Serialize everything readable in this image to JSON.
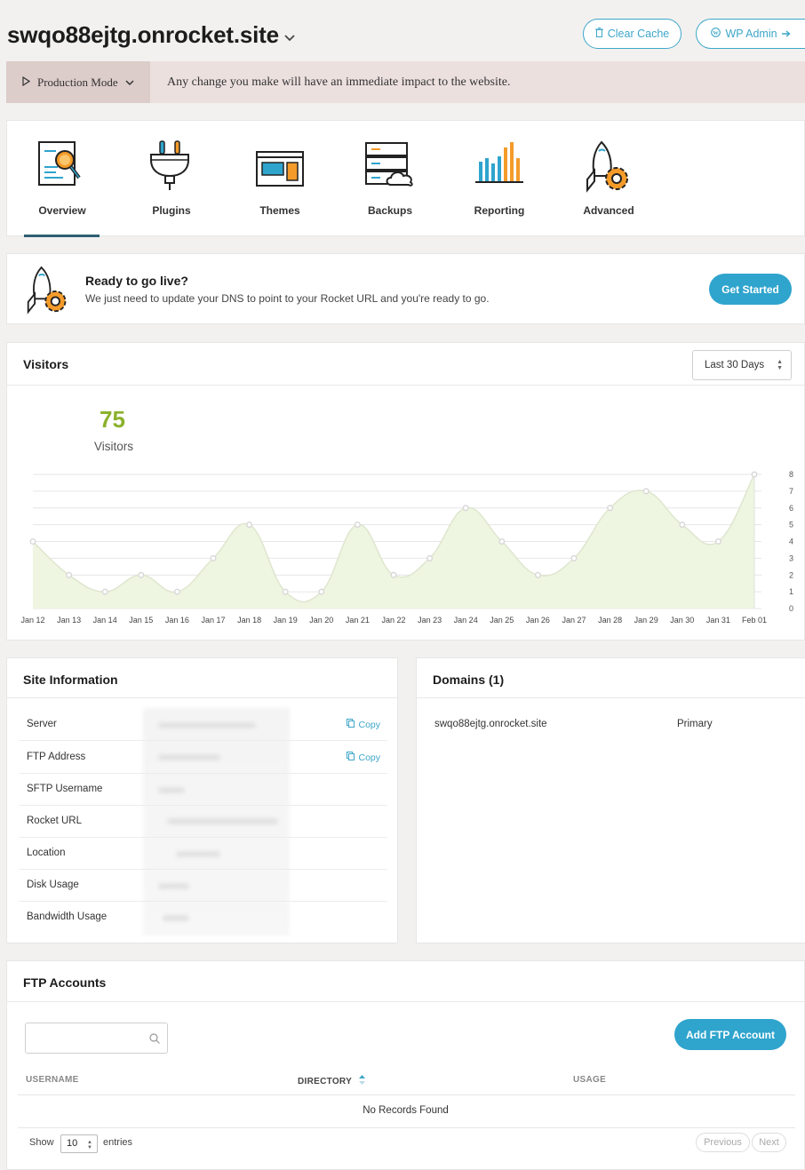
{
  "header": {
    "site_title": "swqo88ejtg.onrocket.site",
    "clear_cache_label": "Clear Cache",
    "wp_admin_label": "WP Admin"
  },
  "production_bar": {
    "mode_label": "Production Mode",
    "message": "Any change you make will have an immediate impact to the website."
  },
  "nav": {
    "items": [
      {
        "label": "Overview",
        "icon": "overview-icon",
        "active": true
      },
      {
        "label": "Plugins",
        "icon": "plug-icon"
      },
      {
        "label": "Themes",
        "icon": "themes-icon"
      },
      {
        "label": "Backups",
        "icon": "backups-icon"
      },
      {
        "label": "Reporting",
        "icon": "reporting-icon"
      },
      {
        "label": "Advanced",
        "icon": "rocket-gear-icon"
      }
    ]
  },
  "go_live": {
    "title": "Ready to go live?",
    "description": "We just need to update your DNS to point to your Rocket URL and you're ready to go.",
    "button_label": "Get Started"
  },
  "visitors": {
    "title": "Visitors",
    "range_label": "Last 30 Days",
    "count": "75",
    "count_label": "Visitors"
  },
  "chart_data": {
    "type": "area",
    "x": [
      "Jan 12",
      "Jan 13",
      "Jan 14",
      "Jan 15",
      "Jan 16",
      "Jan 17",
      "Jan 18",
      "Jan 19",
      "Jan 20",
      "Jan 21",
      "Jan 22",
      "Jan 23",
      "Jan 24",
      "Jan 25",
      "Jan 26",
      "Jan 27",
      "Jan 28",
      "Jan 29",
      "Jan 30",
      "Jan 31",
      "Feb 01"
    ],
    "values": [
      4,
      2,
      1,
      2,
      1,
      3,
      5,
      1,
      1,
      5,
      2,
      3,
      6,
      4,
      2,
      3,
      6,
      7,
      5,
      4,
      8
    ],
    "ylim": [
      0,
      8
    ],
    "yticks": [
      "0",
      "1",
      "2",
      "3",
      "4",
      "5",
      "6",
      "7",
      "8"
    ],
    "y_axis_side": "right",
    "grid": true,
    "colors": {
      "fill": "#eef5e1",
      "line": "#dfe6cf",
      "point": "#d6d6d6",
      "grid": "#e6e6e6"
    }
  },
  "site_info": {
    "title": "Site Information",
    "copy_label": "Copy",
    "rows": [
      {
        "label": "Server",
        "copyable": true
      },
      {
        "label": "FTP Address",
        "copyable": true
      },
      {
        "label": "SFTP Username"
      },
      {
        "label": "Rocket URL"
      },
      {
        "label": "Location"
      },
      {
        "label": "Disk Usage"
      },
      {
        "label": "Bandwidth Usage"
      }
    ]
  },
  "domains": {
    "title": "Domains (1)",
    "rows": [
      {
        "name": "swqo88ejtg.onrocket.site",
        "type": "Primary"
      }
    ]
  },
  "ftp": {
    "title": "FTP Accounts",
    "search_value": "",
    "add_label": "Add FTP Account",
    "columns": [
      "USERNAME",
      "DIRECTORY",
      "USAGE"
    ],
    "empty_message": "No Records Found",
    "show_label": "Show",
    "page_size": "10",
    "entries_label": "entries",
    "prev_label": "Previous",
    "next_label": "Next"
  },
  "colors": {
    "accent": "#2fa4cd",
    "nav_active": "#2e5f73",
    "visitor_count": "#8bb12c",
    "production_bar": "#ece0df"
  }
}
